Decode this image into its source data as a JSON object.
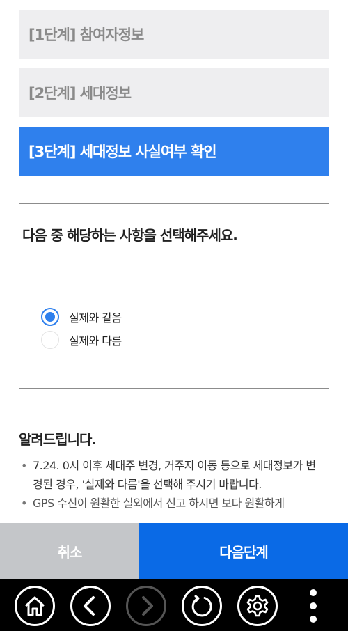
{
  "steps": [
    {
      "label": "[1단계] 참여자정보",
      "active": false
    },
    {
      "label": "[2단계] 세대정보",
      "active": false
    },
    {
      "label": "[3단계] 세대정보 사실여부 확인",
      "active": true
    }
  ],
  "question": "다음 중 해당하는 사항을 선택해주세요.",
  "options": [
    {
      "label": "실제와 같음",
      "selected": true
    },
    {
      "label": "실제와 다름",
      "selected": false
    }
  ],
  "notice": {
    "title": "알려드립니다.",
    "items": [
      "7.24. 0시 이후 세대주 변경, 거주지 이동 등으로 세대정보가 변경된 경우, '실제와 다름'을 선택해 주시기 바랍니다.",
      "GPS 수신이 원활한 실외에서 신고 하시면 보다 원활하게"
    ]
  },
  "actions": {
    "cancel": "취소",
    "next": "다음단계"
  },
  "colors": {
    "accent": "#2f80ed",
    "next_button": "#0a6ae6",
    "cancel_button": "#c4c6c9",
    "step_inactive_bg": "#eeeef0"
  },
  "nav": {
    "icons": [
      "home-icon",
      "back-icon",
      "forward-icon",
      "refresh-icon",
      "settings-icon",
      "more-icon"
    ]
  }
}
